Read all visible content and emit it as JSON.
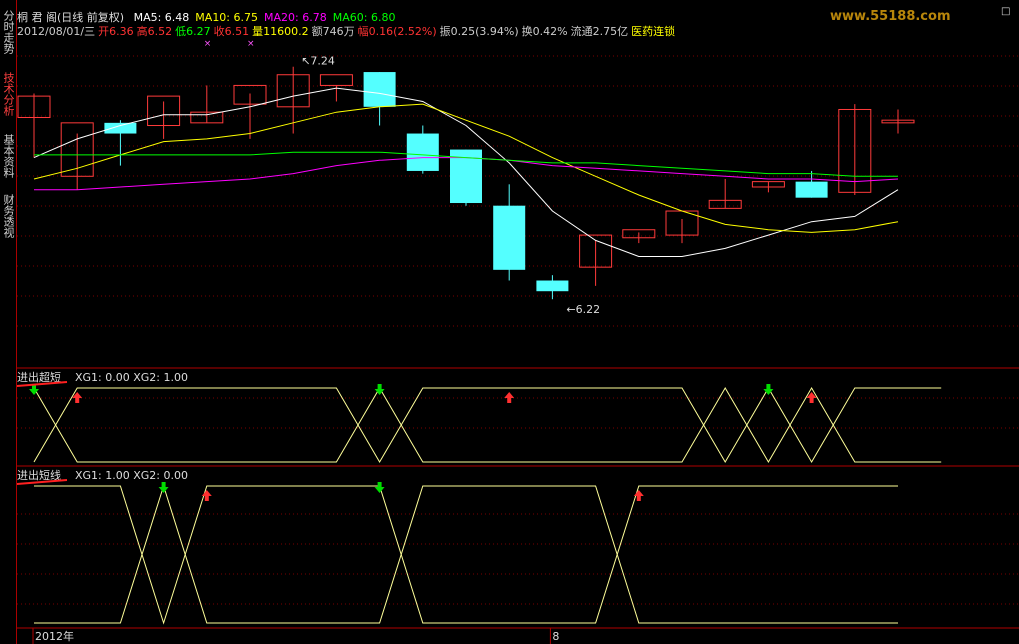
{
  "sidebar": {
    "tabs": [
      {
        "label": "分时走势",
        "active": false
      },
      {
        "label": "技术分析",
        "active": true
      },
      {
        "label": "基本资料",
        "active": false
      },
      {
        "label": "财务透视",
        "active": false
      }
    ]
  },
  "header": {
    "stock_name": "桐 君 阁(日线 前复权)",
    "ma": [
      {
        "label": "MA5: 6.48",
        "color": "#ffffff"
      },
      {
        "label": "MA10: 6.75",
        "color": "#ffff00"
      },
      {
        "label": "MA20: 6.78",
        "color": "#ff00ff"
      },
      {
        "label": "MA60: 6.80",
        "color": "#00ff00"
      }
    ],
    "info_line": [
      {
        "text": "2012/08/01/三",
        "color": "#cccccc"
      },
      {
        "text": "开6.36",
        "color": "#ff3333"
      },
      {
        "text": "高6.52",
        "color": "#ff3333"
      },
      {
        "text": "低6.27",
        "color": "#00ff00"
      },
      {
        "text": "收6.51",
        "color": "#ff3333"
      },
      {
        "text": "量11600.2",
        "color": "#ffff00"
      },
      {
        "text": "额746万",
        "color": "#cccccc"
      },
      {
        "text": "幅0.16(2.52%)",
        "color": "#ff3333"
      },
      {
        "text": "振0.25(3.94%)",
        "color": "#cccccc"
      },
      {
        "text": "换0.42%",
        "color": "#cccccc"
      },
      {
        "text": "流通2.75亿",
        "color": "#cccccc"
      },
      {
        "text": "医药连锁",
        "color": "#ffff00"
      }
    ],
    "watermark": "www.55188.com",
    "maximize_label": "□"
  },
  "chart_data": [
    {
      "type": "candlestick",
      "title": "桐 君 阁(日线 前复权)",
      "ylim": [
        6.14,
        7.3
      ],
      "high_label": "7.24",
      "low_label": "6.22",
      "candles": [
        {
          "o": 7.01,
          "h": 7.1,
          "l": 6.86,
          "c": 7.09
        },
        {
          "o": 6.79,
          "h": 6.95,
          "l": 6.74,
          "c": 6.99
        },
        {
          "o": 6.99,
          "h": 7.0,
          "l": 6.83,
          "c": 6.95
        },
        {
          "o": 6.98,
          "h": 7.07,
          "l": 6.93,
          "c": 7.09
        },
        {
          "o": 6.99,
          "h": 7.13,
          "l": 6.99,
          "c": 7.03
        },
        {
          "o": 7.06,
          "h": 7.1,
          "l": 6.93,
          "c": 7.13
        },
        {
          "o": 7.05,
          "h": 7.2,
          "l": 6.95,
          "c": 7.17
        },
        {
          "o": 7.13,
          "h": 7.13,
          "l": 7.07,
          "c": 7.17
        },
        {
          "o": 7.18,
          "h": 7.18,
          "l": 6.98,
          "c": 7.05
        },
        {
          "o": 6.95,
          "h": 6.98,
          "l": 6.8,
          "c": 6.81
        },
        {
          "o": 6.89,
          "h": 6.89,
          "l": 6.68,
          "c": 6.69
        },
        {
          "o": 6.68,
          "h": 6.76,
          "l": 6.4,
          "c": 6.44
        },
        {
          "o": 6.4,
          "h": 6.42,
          "l": 6.33,
          "c": 6.36
        },
        {
          "o": 6.45,
          "h": 6.55,
          "l": 6.38,
          "c": 6.57
        },
        {
          "o": 6.56,
          "h": 6.58,
          "l": 6.54,
          "c": 6.59
        },
        {
          "o": 6.57,
          "h": 6.63,
          "l": 6.54,
          "c": 6.66
        },
        {
          "o": 6.67,
          "h": 6.78,
          "l": 6.67,
          "c": 6.7
        },
        {
          "o": 6.75,
          "h": 6.77,
          "l": 6.73,
          "c": 6.77
        },
        {
          "o": 6.77,
          "h": 6.81,
          "l": 6.71,
          "c": 6.71
        },
        {
          "o": 6.73,
          "h": 7.06,
          "l": 6.72,
          "c": 7.04
        },
        {
          "o": 6.99,
          "h": 7.04,
          "l": 6.95,
          "c": 7.0
        }
      ],
      "series": [
        {
          "name": "MA5",
          "color": "#ffffff",
          "values": [
            6.86,
            6.93,
            6.98,
            7.02,
            7.02,
            7.05,
            7.09,
            7.12,
            7.1,
            7.07,
            6.98,
            6.84,
            6.66,
            6.55,
            6.49,
            6.49,
            6.52,
            6.57,
            6.62,
            6.64,
            6.74
          ]
        },
        {
          "name": "MA10",
          "color": "#ffff00",
          "values": [
            6.78,
            6.82,
            6.87,
            6.92,
            6.93,
            6.95,
            6.99,
            7.03,
            7.05,
            7.06,
            7.0,
            6.94,
            6.86,
            6.79,
            6.72,
            6.66,
            6.61,
            6.59,
            6.58,
            6.59,
            6.62
          ]
        },
        {
          "name": "MA20",
          "color": "#ff00ff",
          "values": [
            6.74,
            6.74,
            6.75,
            6.76,
            6.77,
            6.78,
            6.8,
            6.83,
            6.85,
            6.86,
            6.86,
            6.85,
            6.83,
            6.82,
            6.81,
            6.8,
            6.79,
            6.78,
            6.78,
            6.77,
            6.78
          ]
        },
        {
          "name": "MA60",
          "color": "#00ff00",
          "values": [
            6.87,
            6.87,
            6.87,
            6.87,
            6.87,
            6.87,
            6.88,
            6.88,
            6.88,
            6.87,
            6.86,
            6.85,
            6.84,
            6.84,
            6.83,
            6.82,
            6.81,
            6.8,
            6.8,
            6.79,
            6.79
          ]
        }
      ],
      "markers_x": [
        4,
        5
      ]
    },
    {
      "type": "line",
      "title": "进出超短",
      "values_label": "XG1: 0.00 XG2: 1.00",
      "series": [
        {
          "name": "XG1",
          "color": "#ffff99",
          "values": [
            0,
            1,
            1,
            1,
            1,
            1,
            1,
            1,
            0,
            1,
            1,
            1,
            1,
            1,
            1,
            1,
            0,
            1,
            0,
            1,
            1,
            1
          ]
        },
        {
          "name": "XG2",
          "color": "#ffff99",
          "values": [
            1,
            0,
            0,
            0,
            0,
            0,
            0,
            0,
            1,
            0,
            0,
            0,
            0,
            0,
            0,
            0,
            1,
            0,
            1,
            0,
            0,
            0
          ]
        }
      ],
      "arrows": [
        {
          "i": 0,
          "dir": "down"
        },
        {
          "i": 1,
          "dir": "up"
        },
        {
          "i": 8,
          "dir": "down"
        },
        {
          "i": 11,
          "dir": "up"
        },
        {
          "i": 17,
          "dir": "down"
        },
        {
          "i": 18,
          "dir": "up"
        }
      ]
    },
    {
      "type": "line",
      "title": "进出短线",
      "values_label": "XG1: 1.00 XG2: 0.00",
      "series": [
        {
          "name": "XG1",
          "color": "#ffff99",
          "values": [
            1,
            1,
            1,
            0,
            1,
            1,
            1,
            1,
            1,
            0,
            0,
            0,
            0,
            0,
            1,
            1,
            1,
            1,
            1,
            1,
            1
          ]
        },
        {
          "name": "XG2",
          "color": "#ffff99",
          "values": [
            0,
            0,
            0,
            1,
            0,
            0,
            0,
            0,
            0,
            1,
            1,
            1,
            1,
            1,
            0,
            0,
            0,
            0,
            0,
            0,
            0
          ]
        }
      ],
      "arrows": [
        {
          "i": 3,
          "dir": "down"
        },
        {
          "i": 4,
          "dir": "up"
        },
        {
          "i": 8,
          "dir": "down"
        },
        {
          "i": 14,
          "dir": "up"
        }
      ]
    }
  ],
  "xaxis": {
    "labels": [
      {
        "text": "2012年",
        "i": 0
      },
      {
        "text": "8",
        "i": 12
      }
    ]
  }
}
